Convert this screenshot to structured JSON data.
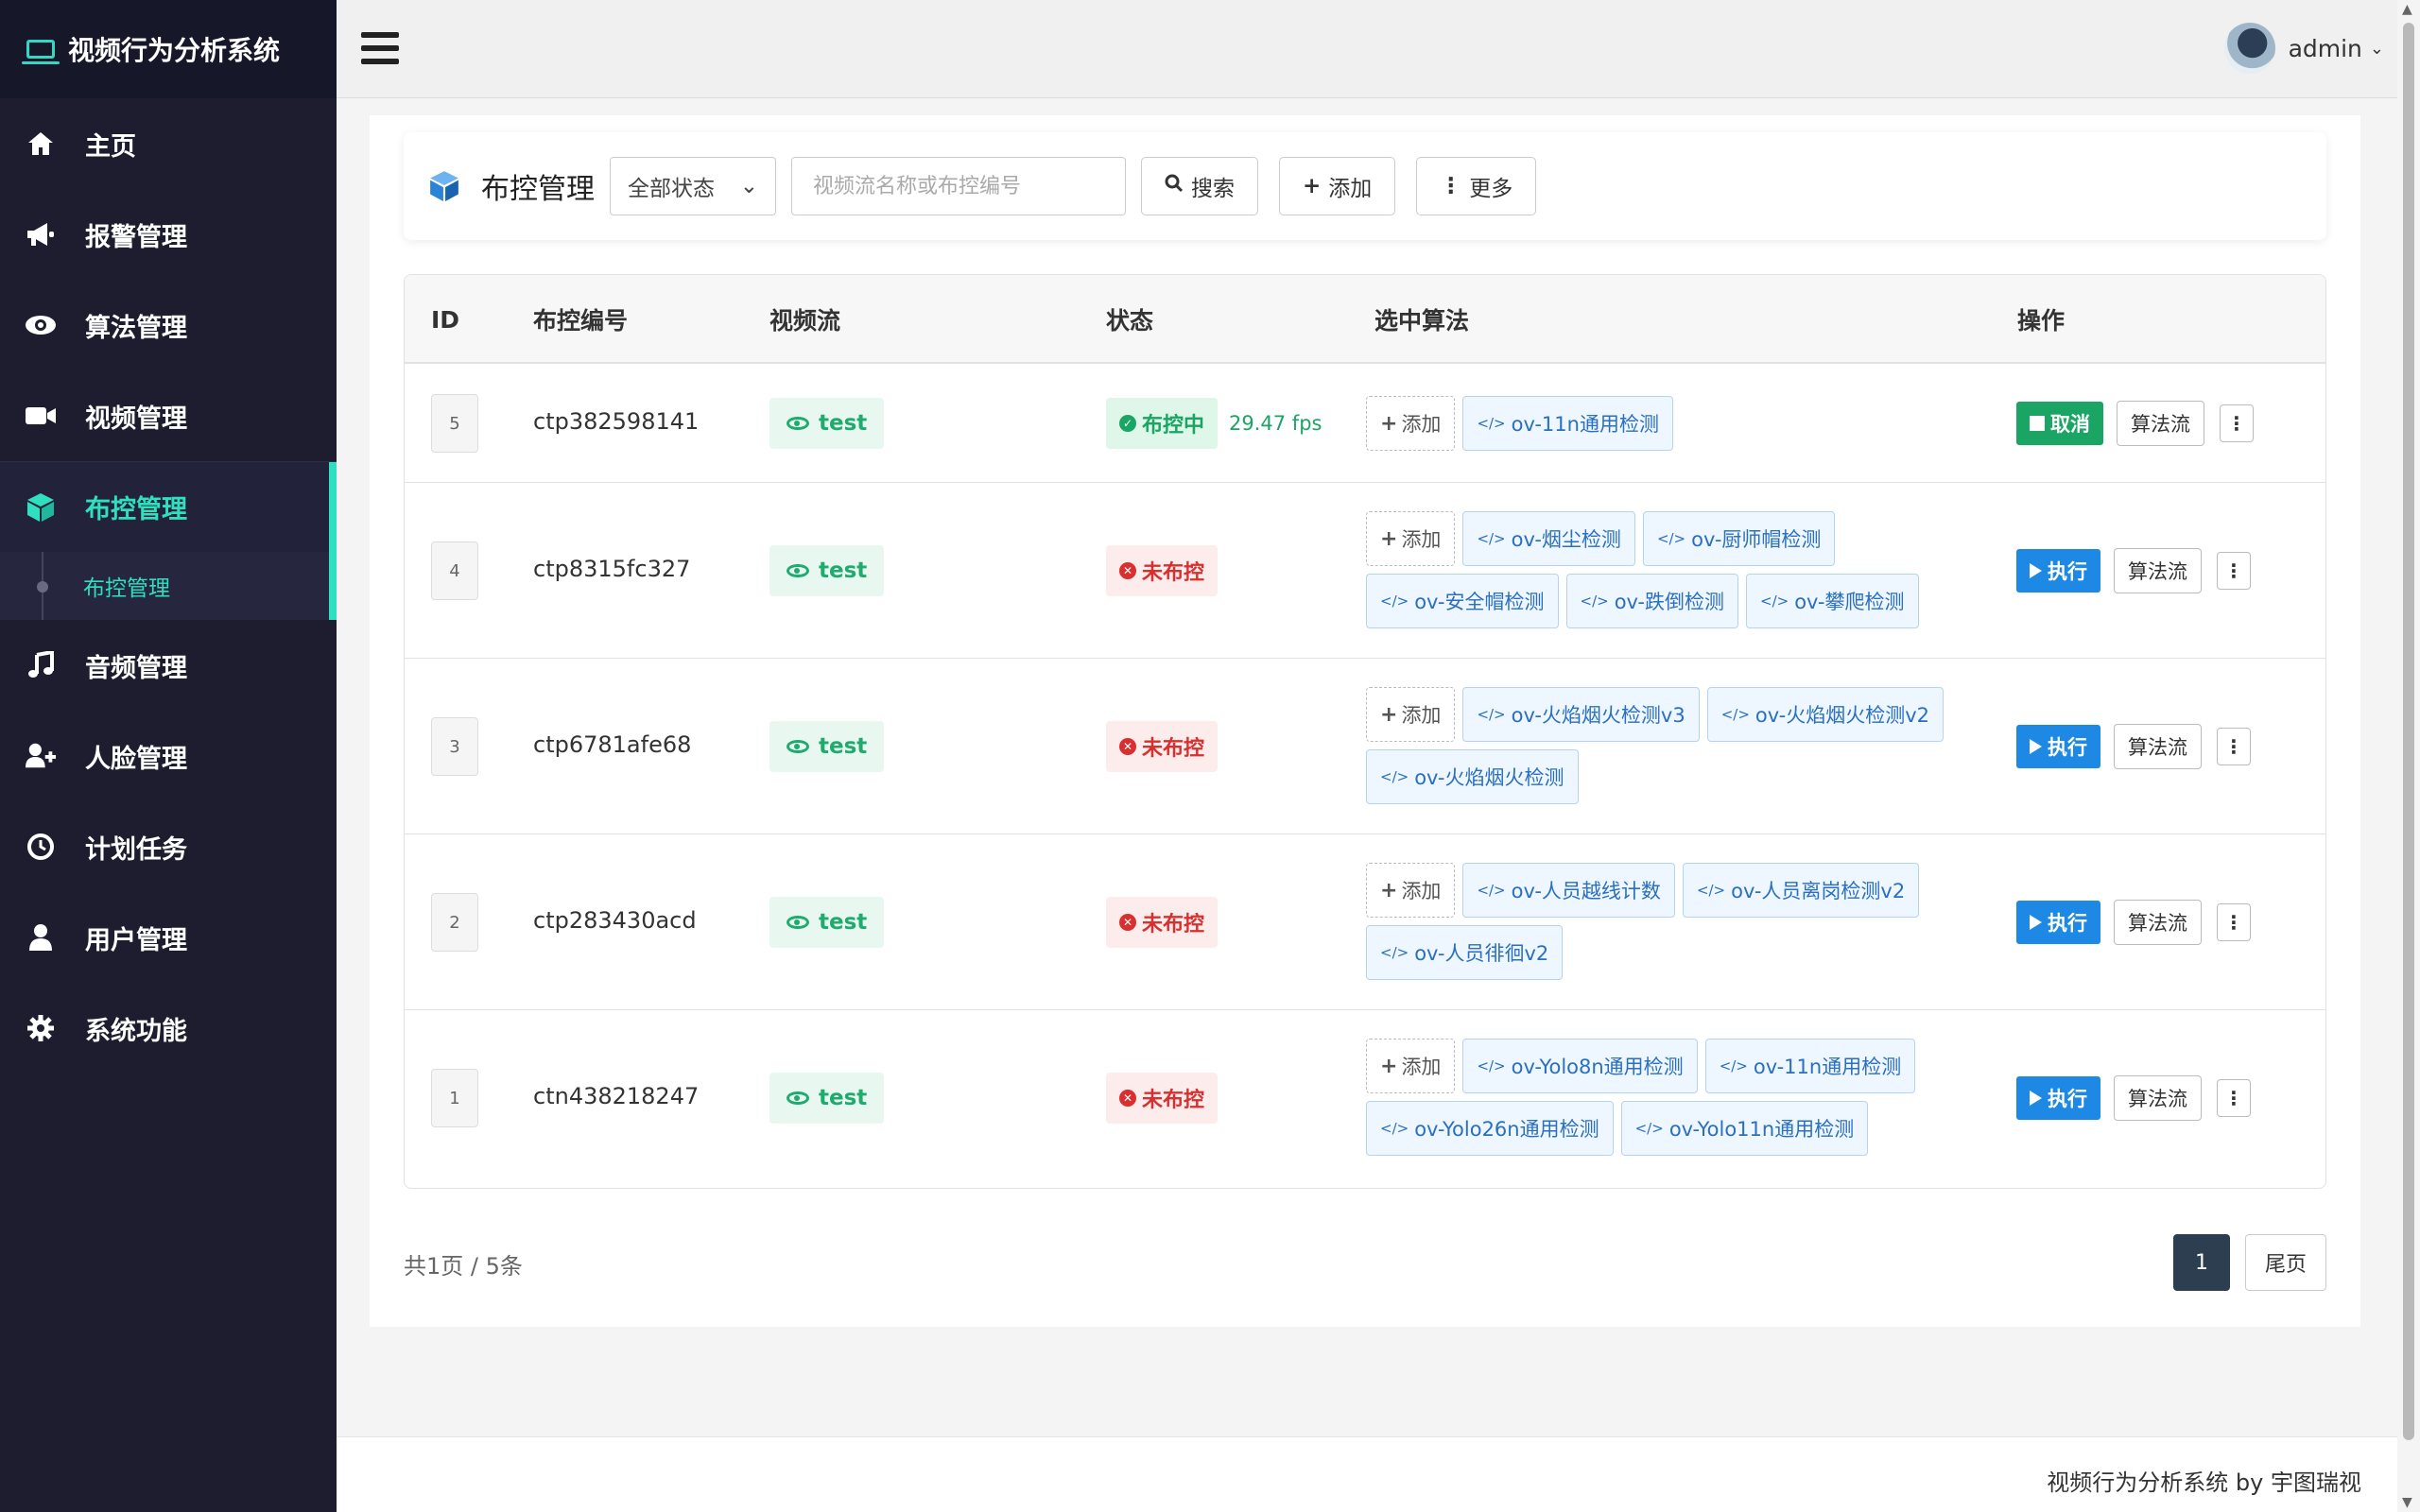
{
  "app": {
    "title": "视频行为分析系统"
  },
  "sidebar": {
    "items": [
      {
        "label": "主页",
        "icon": "home-icon"
      },
      {
        "label": "报警管理",
        "icon": "megaphone-icon"
      },
      {
        "label": "算法管理",
        "icon": "eye-icon"
      },
      {
        "label": "视频管理",
        "icon": "video-camera-icon"
      },
      {
        "label": "布控管理",
        "icon": "cube-icon"
      },
      {
        "label": "音频管理",
        "icon": "music-note-icon"
      },
      {
        "label": "人脸管理",
        "icon": "user-plus-icon"
      },
      {
        "label": "计划任务",
        "icon": "clock-icon"
      },
      {
        "label": "用户管理",
        "icon": "user-icon"
      },
      {
        "label": "系统功能",
        "icon": "gear-icon"
      }
    ],
    "sub_item": "布控管理",
    "accent": "#2ee0c0"
  },
  "header": {
    "username": "admin"
  },
  "toolbar": {
    "title": "布控管理",
    "status_select": "全部状态",
    "search_placeholder": "视频流名称或布控编号",
    "search_label": "搜索",
    "add_label": "添加",
    "more_label": "更多"
  },
  "table": {
    "columns": [
      "ID",
      "布控编号",
      "视频流",
      "状态",
      "选中算法",
      "操作"
    ],
    "add_tag_label": "添加",
    "algo_stream_label": "算法流",
    "rows": [
      {
        "id": "5",
        "code": "ctp382598141",
        "stream": "test",
        "status": "布控中",
        "running": true,
        "fps": "29.47 fps",
        "algos": [
          "ov-11n通用检测"
        ],
        "action": "取消"
      },
      {
        "id": "4",
        "code": "ctp8315fc327",
        "stream": "test",
        "status": "未布控",
        "running": false,
        "fps": "",
        "algos": [
          "ov-烟尘检测",
          "ov-厨师帽检测",
          "ov-安全帽检测",
          "ov-跌倒检测",
          "ov-攀爬检测"
        ],
        "action": "执行"
      },
      {
        "id": "3",
        "code": "ctp6781afe68",
        "stream": "test",
        "status": "未布控",
        "running": false,
        "fps": "",
        "algos": [
          "ov-火焰烟火检测v3",
          "ov-火焰烟火检测v2",
          "ov-火焰烟火检测"
        ],
        "action": "执行"
      },
      {
        "id": "2",
        "code": "ctp283430acd",
        "stream": "test",
        "status": "未布控",
        "running": false,
        "fps": "",
        "algos": [
          "ov-人员越线计数",
          "ov-人员离岗检测v2",
          "ov-人员徘徊v2"
        ],
        "action": "执行"
      },
      {
        "id": "1",
        "code": "ctn438218247",
        "stream": "test",
        "status": "未布控",
        "running": false,
        "fps": "",
        "algos": [
          "ov-Yolo8n通用检测",
          "ov-11n通用检测",
          "ov-Yolo26n通用检测",
          "ov-Yolo11n通用检测"
        ],
        "action": "执行"
      }
    ]
  },
  "pagination": {
    "summary": "共1页 / 5条",
    "current": "1",
    "last_label": "尾页"
  },
  "footer": {
    "text": "视频行为分析系统 by 宇图瑞视"
  }
}
